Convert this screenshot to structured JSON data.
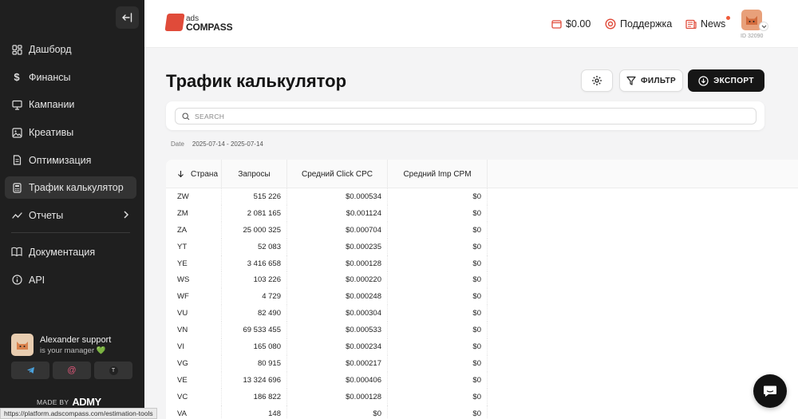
{
  "sidebar": {
    "items": [
      {
        "label": "Дашборд",
        "icon": "dashboard-icon"
      },
      {
        "label": "Финансы",
        "icon": "dollar-icon"
      },
      {
        "label": "Кампании",
        "icon": "monitor-icon"
      },
      {
        "label": "Креативы",
        "icon": "image-icon"
      },
      {
        "label": "Оптимизация",
        "icon": "document-icon"
      },
      {
        "label": "Трафик калькулятор",
        "icon": "calculator-icon"
      },
      {
        "label": "Отчеты",
        "icon": "chart-icon"
      },
      {
        "label": "Документация",
        "icon": "book-icon"
      },
      {
        "label": "API",
        "icon": "info-icon"
      }
    ],
    "manager": {
      "name": "Alexander support",
      "subtitle": "is your manager 💚"
    },
    "contacts": [
      {
        "icon": "telegram-icon"
      },
      {
        "icon": "at-icon"
      },
      {
        "icon": "skype-icon",
        "label": "T"
      }
    ],
    "made_by_label": "MADE BY",
    "made_by_brand": "ADMY"
  },
  "status_url": "https://platform.adscompass.com/estimation-tools",
  "header": {
    "logo_top": "ads",
    "logo_bottom": "COMPASS",
    "balance": "$0.00",
    "support_label": "Поддержка",
    "news_label": "News",
    "user_id": "ID 32090"
  },
  "page": {
    "title": "Трафик калькулятор",
    "filter_label": "ФИЛЬТР",
    "export_label": "ЭКСПОРТ",
    "search_placeholder": "SEARCH",
    "date_label": "Date",
    "date_range": "2025-07-14 - 2025-07-14"
  },
  "table": {
    "headers": [
      "Страна",
      "Запросы",
      "Средний Click CPC",
      "Средний Imp CPM"
    ],
    "rows": [
      [
        "ZW",
        "515 226",
        "$0.000534",
        "$0"
      ],
      [
        "ZM",
        "2 081 165",
        "$0.001124",
        "$0"
      ],
      [
        "ZA",
        "25 000 325",
        "$0.000704",
        "$0"
      ],
      [
        "YT",
        "52 083",
        "$0.000235",
        "$0"
      ],
      [
        "YE",
        "3 416 658",
        "$0.000128",
        "$0"
      ],
      [
        "WS",
        "103 226",
        "$0.000220",
        "$0"
      ],
      [
        "WF",
        "4 729",
        "$0.000248",
        "$0"
      ],
      [
        "VU",
        "82 490",
        "$0.000304",
        "$0"
      ],
      [
        "VN",
        "69 533 455",
        "$0.000533",
        "$0"
      ],
      [
        "VI",
        "165 080",
        "$0.000234",
        "$0"
      ],
      [
        "VG",
        "80 915",
        "$0.000217",
        "$0"
      ],
      [
        "VE",
        "13 324 696",
        "$0.000406",
        "$0"
      ],
      [
        "VC",
        "186 822",
        "$0.000128",
        "$0"
      ],
      [
        "VA",
        "148",
        "$0",
        "$0"
      ]
    ]
  },
  "colors": {
    "sidebar_bg": "#1f1f1f",
    "accent": "#e04b3a",
    "primary_button": "#161616"
  }
}
